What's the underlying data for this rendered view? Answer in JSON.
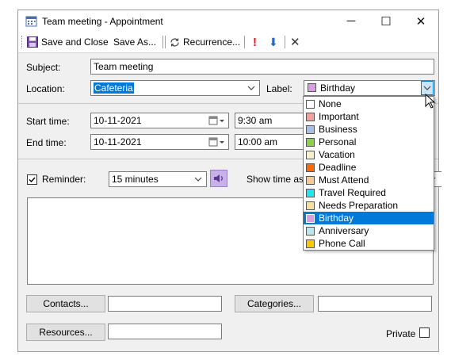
{
  "window": {
    "title": "Team meeting - Appointment",
    "controls": [
      "─",
      "☐",
      "✕"
    ]
  },
  "toolbar": {
    "save_close": "Save and Close",
    "save_as": "Save As...",
    "recurrence": "Recurrence...",
    "importance_glyph": "!",
    "low_importance_glyph": "⬇",
    "delete_glyph": "✕"
  },
  "form": {
    "subject_label": "Subject:",
    "subject_value": "Team meeting",
    "location_label": "Location:",
    "location_value": "Cafeteria",
    "label_label": "Label:",
    "label_value": "Birthday",
    "label_color": "#d8a0e0",
    "start_label": "Start time:",
    "start_date": "10-11-2021",
    "start_time": "9:30 am",
    "end_label": "End time:",
    "end_date": "10-11-2021",
    "end_time": "10:00 am",
    "reminder_label": "Reminder:",
    "reminder_value": "15 minutes",
    "show_time_as_label": "Show time as:",
    "contacts_button": "Contacts...",
    "categories_button": "Categories...",
    "resources_button": "Resources...",
    "private_label": "Private"
  },
  "label_options": [
    {
      "label": "None",
      "color": "#ffffff"
    },
    {
      "label": "Important",
      "color": "#f4a0a0"
    },
    {
      "label": "Business",
      "color": "#a8c0e8"
    },
    {
      "label": "Personal",
      "color": "#8ed04a"
    },
    {
      "label": "Vacation",
      "color": "#f5f0d0"
    },
    {
      "label": "Deadline",
      "color": "#ff6a00"
    },
    {
      "label": "Must Attend",
      "color": "#f5c898"
    },
    {
      "label": "Travel Required",
      "color": "#20e8f0"
    },
    {
      "label": "Needs Preparation",
      "color": "#f5e0a0"
    },
    {
      "label": "Birthday",
      "color": "#d8a0e0",
      "selected": true
    },
    {
      "label": "Anniversary",
      "color": "#b8e8f0"
    },
    {
      "label": "Phone Call",
      "color": "#f8c800"
    }
  ],
  "colors": {
    "selection": "#0078d7",
    "speaker_icon_bg": "#c8b0e8",
    "importance_red": "#e81123",
    "arrow_blue": "#2266d0"
  }
}
